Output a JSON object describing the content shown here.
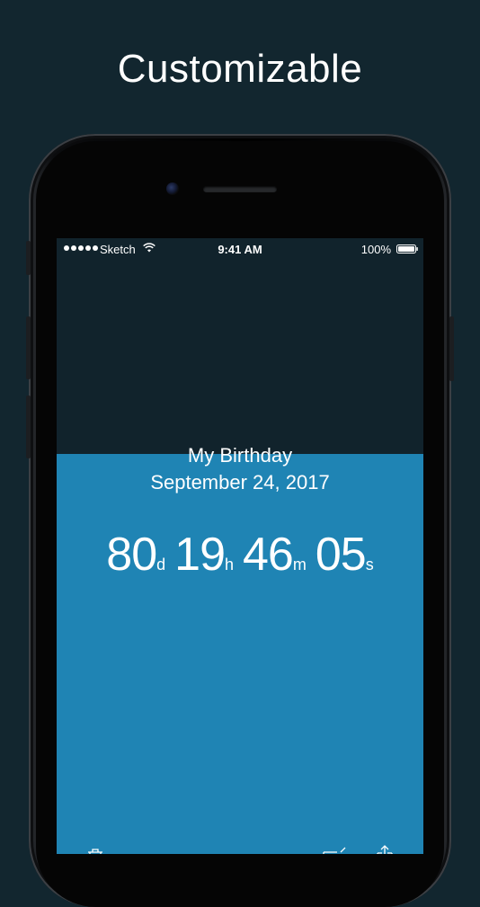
{
  "headline": "Customizable",
  "status_bar": {
    "carrier": "Sketch",
    "time": "9:41 AM",
    "battery": "100%",
    "signal_icon": "signal-dots-icon",
    "wifi_icon": "wifi-icon",
    "battery_icon": "battery-icon"
  },
  "event": {
    "title": "My Birthday",
    "date": "September 24, 2017"
  },
  "countdown": {
    "days": "80",
    "days_unit": "d",
    "hours": "19",
    "hours_unit": "h",
    "minutes": "46",
    "minutes_unit": "m",
    "seconds": "05",
    "seconds_unit": "s"
  },
  "toolbar": {
    "delete_icon": "trash-icon",
    "edit_icon": "edit-icon",
    "share_icon": "share-icon"
  },
  "colors": {
    "page_background": "#12262f",
    "screen_background": "#11232c",
    "progress_fill": "#1f84b4",
    "text": "#ffffff"
  },
  "progress_fraction": 0.65
}
